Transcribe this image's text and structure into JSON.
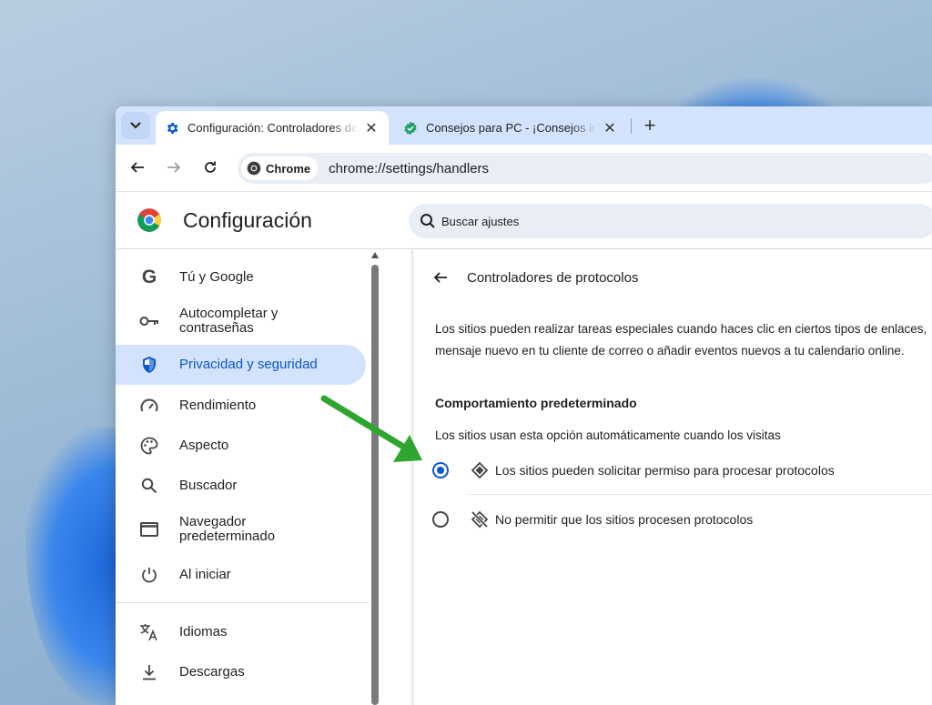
{
  "tabs": [
    {
      "title": "Configuración: Controladores de protocolos",
      "icon": "gear-icon",
      "active": true
    },
    {
      "title": "Consejos para PC - ¡Consejos inteligentes!",
      "icon": "verified-badge-icon",
      "active": false
    }
  ],
  "toolbar": {
    "chip_label": "Chrome",
    "url": "chrome://settings/handlers"
  },
  "header": {
    "title": "Configuración",
    "search_placeholder": "Buscar ajustes"
  },
  "sidebar": {
    "items": [
      {
        "label": "Tú y Google",
        "icon": "google-g-icon"
      },
      {
        "label": "Autocompletar y contraseñas",
        "icon": "key-icon"
      },
      {
        "label": "Privacidad y seguridad",
        "icon": "shield-icon",
        "selected": true
      },
      {
        "label": "Rendimiento",
        "icon": "speedometer-icon"
      },
      {
        "label": "Aspecto",
        "icon": "palette-icon"
      },
      {
        "label": "Buscador",
        "icon": "search-icon"
      },
      {
        "label": "Navegador predeterminado",
        "icon": "browser-window-icon"
      },
      {
        "label": "Al iniciar",
        "icon": "power-icon"
      },
      {
        "label": "Idiomas",
        "icon": "translate-icon"
      },
      {
        "label": "Descargas",
        "icon": "download-icon"
      }
    ]
  },
  "main": {
    "title": "Controladores de protocolos",
    "description_line1": "Los sitios pueden realizar tareas especiales cuando haces clic en ciertos tipos de enlaces,",
    "description_line2": "mensaje nuevo en tu cliente de correo o añadir eventos nuevos a tu calendario online.",
    "section_title": "Comportamiento predeterminado",
    "section_subtitle": "Los sitios usan esta opción automáticamente cuando los visitas",
    "options": [
      {
        "label": "Los sitios pueden solicitar permiso para procesar protocolos",
        "checked": true,
        "icon": "protocol-handler-icon"
      },
      {
        "label": "No permitir que los sitios procesen protocolos",
        "checked": false,
        "icon": "protocol-handler-off-icon"
      }
    ]
  },
  "colors": {
    "accent": "#0b57d0",
    "selected_bg": "#d3e3fd",
    "annotation_arrow": "#2ea52e"
  }
}
